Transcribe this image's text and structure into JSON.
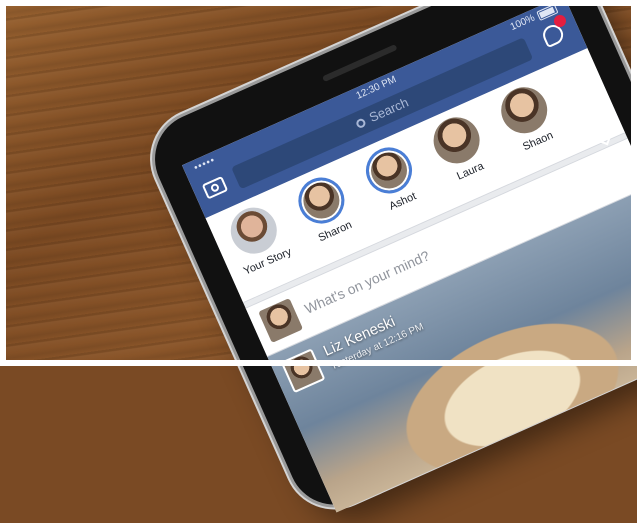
{
  "status": {
    "carrier": "•••••",
    "time": "12:30 PM",
    "battery": "100%"
  },
  "header": {
    "search_label": "Search",
    "notification_count": ""
  },
  "stories": [
    {
      "name": "Your Story"
    },
    {
      "name": "Sharon"
    },
    {
      "name": "Ashot"
    },
    {
      "name": "Laura"
    },
    {
      "name": "Shaon"
    }
  ],
  "composer": {
    "placeholder": "What's on your mind?"
  },
  "post": {
    "author": "Liz Keneski",
    "meta": "Yesterday at 12:16 PM"
  },
  "colors": {
    "brand": "#3b5998",
    "story_ring": "#4a7ed6",
    "badge": "#e41e3f"
  }
}
